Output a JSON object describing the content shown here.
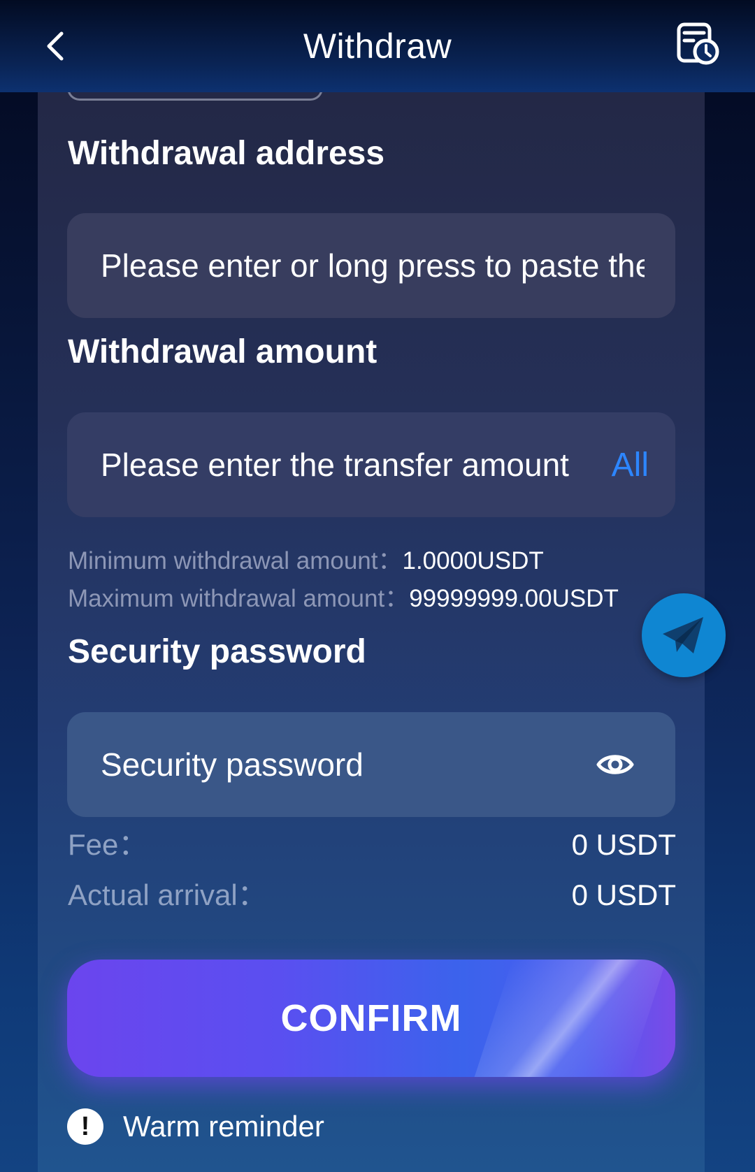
{
  "header": {
    "title": "Withdraw",
    "back_icon": "chevron-left-icon",
    "history_icon": "record-history-icon"
  },
  "address": {
    "label": "Withdrawal address",
    "placeholder": "Please enter or long press to paste the address"
  },
  "amount": {
    "label": "Withdrawal amount",
    "placeholder": "Please enter the transfer amount",
    "all_label": "All",
    "min_label": "Minimum withdrawal amount：",
    "min_value": "1.0000USDT",
    "max_label": "Maximum withdrawal amount：",
    "max_value": "99999999.00USDT"
  },
  "password": {
    "label": "Security password",
    "placeholder": "Security password",
    "eye_icon": "eye-icon"
  },
  "fee": {
    "label": "Fee：",
    "value": "0 USDT"
  },
  "arrival": {
    "label": "Actual arrival：",
    "value": "0 USDT"
  },
  "confirm_label": "CONFIRM",
  "reminder": {
    "icon": "exclamation-circle-icon",
    "text": "Warm reminder"
  },
  "floating": {
    "telegram_icon": "telegram-icon"
  },
  "colors": {
    "accent_blue": "#2d86ff",
    "confirm_gradient_start": "#6b45ee",
    "confirm_gradient_end": "#3b63ec",
    "telegram": "#0f86d2"
  }
}
